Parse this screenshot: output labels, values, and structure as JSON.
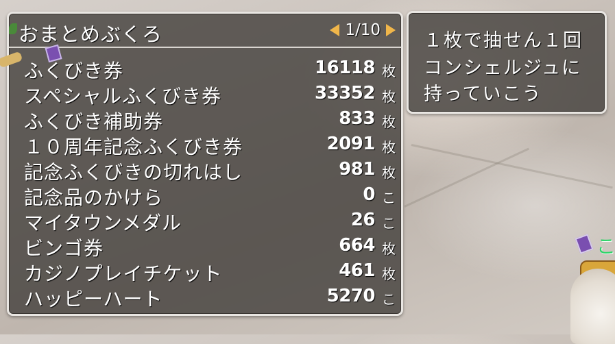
{
  "bag_window": {
    "title": "おまとめぶくろ",
    "page": "1/10",
    "items": [
      {
        "name": "ふくびき券",
        "count": "16118",
        "unit": "枚"
      },
      {
        "name": "スペシャルふくびき券",
        "count": "33352",
        "unit": "枚"
      },
      {
        "name": "ふくびき補助券",
        "count": "833",
        "unit": "枚"
      },
      {
        "name": "１０周年記念ふくびき券",
        "count": "2091",
        "unit": "枚"
      },
      {
        "name": "記念ふくびきの切れはし",
        "count": "981",
        "unit": "枚"
      },
      {
        "name": "記念品のかけら",
        "count": "0",
        "unit": "こ"
      },
      {
        "name": "マイタウンメダル",
        "count": "26",
        "unit": "こ"
      },
      {
        "name": "ビンゴ券",
        "count": "664",
        "unit": "枚"
      },
      {
        "name": "カジノプレイチケット",
        "count": "461",
        "unit": "枚"
      },
      {
        "name": "ハッピーハート",
        "count": "5270",
        "unit": "こ"
      }
    ]
  },
  "message_window": {
    "lines": [
      "１枚で抽せん１回",
      "コンシェルジュに",
      "持っていこう"
    ]
  },
  "side_label": "こ",
  "colors": {
    "window_bg": "#46423e",
    "window_border": "#e9e6e2",
    "arrow": "#f0b64a",
    "side_text": "#2fd46a"
  },
  "icons": [
    "chevron-left-icon",
    "chevron-right-icon",
    "item-card-icon"
  ]
}
